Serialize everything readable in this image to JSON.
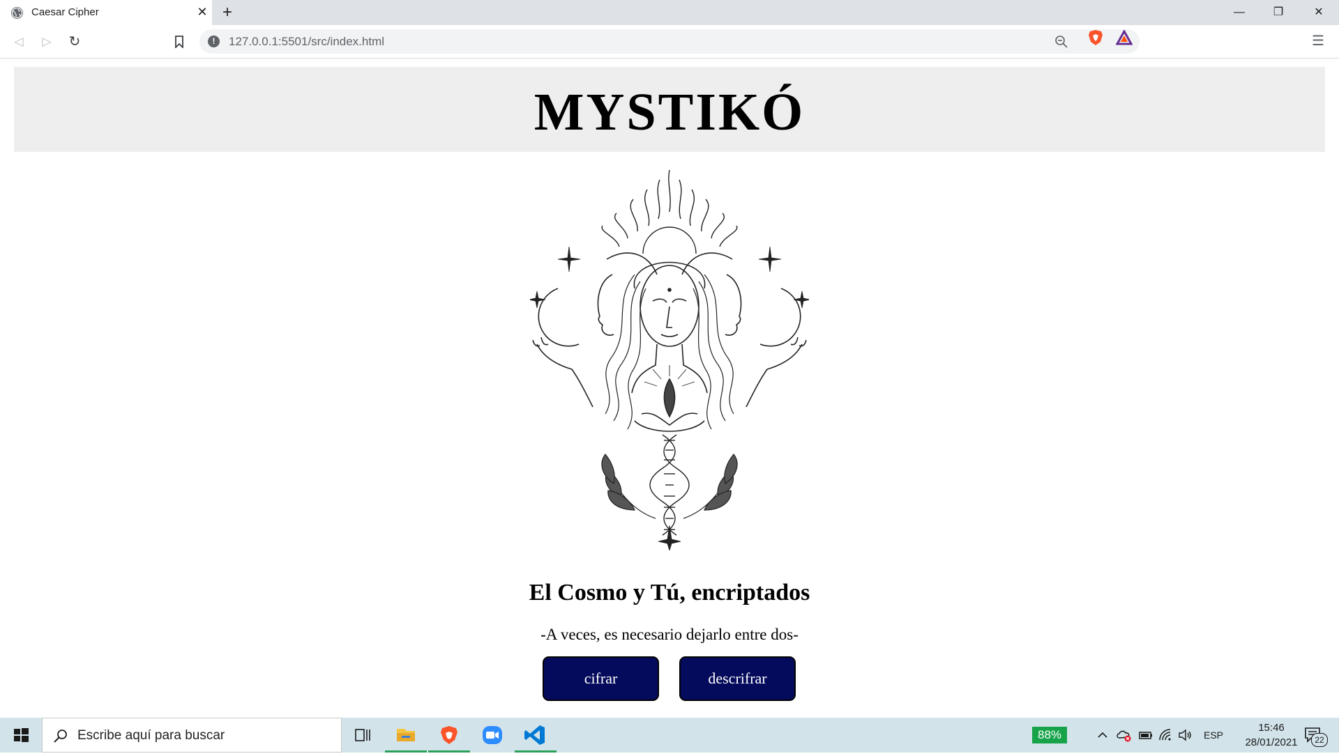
{
  "browser": {
    "tab_title": "Caesar Cipher",
    "tab_close": "✕",
    "new_tab": "+",
    "url": "127.0.0.1:5501/src/index.html",
    "window": {
      "minimize": "—",
      "maximize": "❐",
      "close": "✕"
    },
    "nav": {
      "back": "◁",
      "forward": "▷",
      "reload": "↻",
      "bookmark": "🔖",
      "menu": "☰"
    }
  },
  "page": {
    "title": "MYSTIKÓ",
    "subtitle": "El Cosmo y Tú, encriptados",
    "tagline": "-A veces, es necesario dejarlo entre dos-",
    "buttons": {
      "encrypt": "cifrar",
      "decrypt": "descrifrar"
    },
    "button_color": "#050b5c"
  },
  "taskbar": {
    "search_placeholder": "Escribe aquí para buscar",
    "battery_percent": "88%",
    "language": "ESP",
    "time": "15:46",
    "date": "28/01/2021",
    "notification_count": "22",
    "apps": [
      "task-view-icon",
      "file-explorer-icon",
      "brave-browser-icon",
      "zoom-icon",
      "vscode-icon"
    ]
  }
}
